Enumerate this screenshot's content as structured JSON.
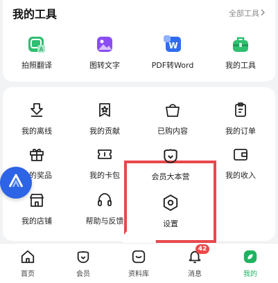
{
  "tools": {
    "title": "我的工具",
    "all_label": "全部工具",
    "items": [
      {
        "label": "拍照翻译",
        "icon": "photo-translate-icon"
      },
      {
        "label": "图转文字",
        "icon": "image-to-text-icon"
      },
      {
        "label": "PDF转Word",
        "icon": "pdf-to-word-icon"
      },
      {
        "label": "我的工具",
        "icon": "toolbox-icon"
      }
    ]
  },
  "grid": {
    "items": [
      {
        "label": "我的离线",
        "icon": "offline-download-icon"
      },
      {
        "label": "我的贡献",
        "icon": "contribution-icon"
      },
      {
        "label": "已购内容",
        "icon": "shopping-bag-icon"
      },
      {
        "label": "我的订单",
        "icon": "order-icon"
      },
      {
        "label": "我的奖品",
        "icon": "gift-icon"
      },
      {
        "label": "我的卡包",
        "icon": "card-ticket-icon"
      },
      {
        "label": "会员大本营",
        "icon": "vip-camp-icon"
      },
      {
        "label": "我的收入",
        "icon": "wallet-icon"
      },
      {
        "label": "我的店铺",
        "icon": "store-icon"
      },
      {
        "label": "帮助与反馈",
        "icon": "headset-icon"
      },
      {
        "label": "设置",
        "icon": "settings-icon"
      }
    ]
  },
  "nav": {
    "items": [
      {
        "label": "首页",
        "icon": "home-icon"
      },
      {
        "label": "会员",
        "icon": "vip-icon"
      },
      {
        "label": "资料库",
        "icon": "library-icon"
      },
      {
        "label": "消息",
        "icon": "bell-icon",
        "badge": "42"
      },
      {
        "label": "我的",
        "icon": "profile-leaf-icon"
      }
    ]
  },
  "colors": {
    "accent": "#1fb361",
    "highlight": "#e8474c",
    "float_button": "#2d64e6",
    "badge": "#f04848"
  }
}
